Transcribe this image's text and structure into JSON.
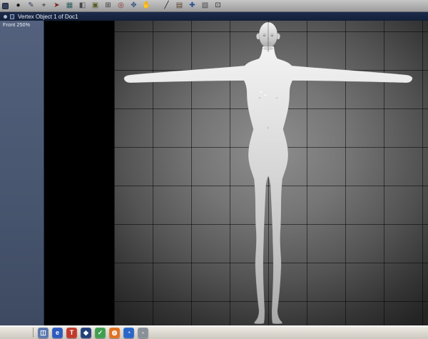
{
  "titlebar": {
    "title": "Vertex Object 1 of Doc1"
  },
  "viewport": {
    "label": "Front 250%",
    "model": "human-figure-t-pose"
  },
  "toolbar": {
    "icons": [
      {
        "name": "select-tool",
        "glyph": "●",
        "color": "#141414"
      },
      {
        "name": "pen-tool",
        "glyph": "✎",
        "color": "#2e3e5e"
      },
      {
        "name": "target-tool",
        "glyph": "⌖",
        "color": "#333333"
      },
      {
        "name": "arrow-tool",
        "glyph": "➤",
        "color": "#7d2420"
      },
      {
        "name": "grid-tool",
        "glyph": "▦",
        "color": "#2e5d5d"
      },
      {
        "name": "half-square-tool",
        "glyph": "◧",
        "color": "#4a4a4a"
      },
      {
        "name": "solid-square-tool",
        "glyph": "▣",
        "color": "#5d5d2a"
      },
      {
        "name": "plus-square-tool",
        "glyph": "⊞",
        "color": "#3a3a3a"
      },
      {
        "name": "bullseye-tool",
        "glyph": "◎",
        "color": "#8d2f2f"
      },
      {
        "name": "star-tool",
        "glyph": "✥",
        "color": "#2f4f7d"
      },
      {
        "name": "hand-tool",
        "glyph": "✋",
        "color": "#8a6a3a"
      },
      {
        "name": "line-tool",
        "glyph": "╱",
        "color": "#1a1a1a"
      },
      {
        "name": "rows-tool",
        "glyph": "▤",
        "color": "#5a3f2a"
      },
      {
        "name": "cross-tool",
        "glyph": "✚",
        "color": "#24508e"
      },
      {
        "name": "hatch-tool",
        "glyph": "▧",
        "color": "#4a4a4a"
      },
      {
        "name": "boxed-dot-tool",
        "glyph": "⊡",
        "color": "#2a2a2a"
      }
    ]
  },
  "taskbar": {
    "icons": [
      {
        "name": "app-window",
        "glyph": "◫",
        "bg": "#5a76ad"
      },
      {
        "name": "app-browser",
        "glyph": "e",
        "bg": "#2f5bbf"
      },
      {
        "name": "app-text",
        "glyph": "T",
        "bg": "#c0392b"
      },
      {
        "name": "app-dark",
        "glyph": "◆",
        "bg": "#23407a"
      },
      {
        "name": "app-notes",
        "glyph": "✓",
        "bg": "#3f9e4f"
      },
      {
        "name": "app-firefox",
        "glyph": "◍",
        "bg": "#e07020"
      },
      {
        "name": "app-globe",
        "glyph": "◔",
        "bg": "#2a66c8"
      },
      {
        "name": "app-gray",
        "glyph": "▫",
        "bg": "#8a9098"
      }
    ]
  },
  "colors": {
    "titlebar_bg": "#16233e",
    "panel_bg": "#4c5a76",
    "viewport_bg": "#000000",
    "grid_center": "#8e8e8e",
    "taskbar_bg": "#d6d2c9",
    "figure": "#d9d9d9"
  }
}
